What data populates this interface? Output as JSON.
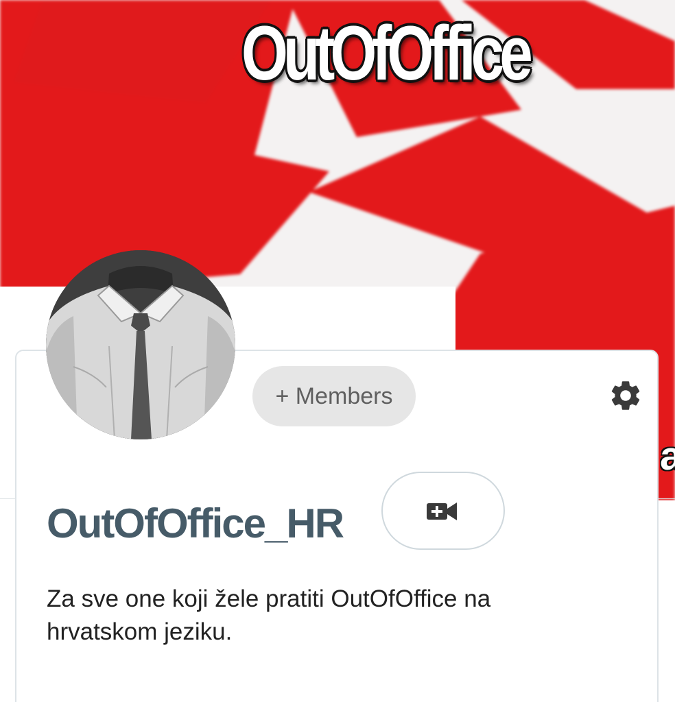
{
  "cover": {
    "title_text": "OutOfOffice",
    "edge_letter": "a",
    "next_icon": "chevron-right-icon",
    "colors": {
      "red": "#e3191b",
      "white": "#f4f2f2"
    }
  },
  "avatar": {
    "icon": "shirt-and-tie-photo"
  },
  "members_chip": {
    "label": "+ Members"
  },
  "settings": {
    "icon": "gear-icon"
  },
  "group": {
    "name": "OutOfOffice_HR",
    "name_color": "#465b68"
  },
  "video_button": {
    "icon": "video-call-add-icon"
  },
  "description": {
    "text": "Za sve one koji žele pratiti OutOfOffice na hrvatskom jeziku."
  }
}
